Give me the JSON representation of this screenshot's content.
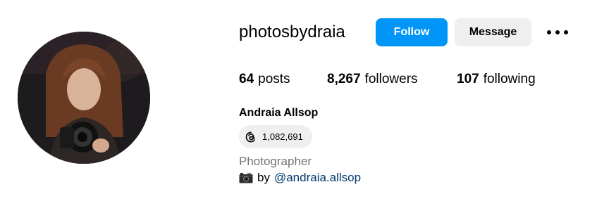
{
  "profile": {
    "username": "photosbydraia",
    "full_name": "Andraia Allsop",
    "category": "Photographer",
    "avatar_icon": "profile-photo-woman-with-camera"
  },
  "actions": {
    "follow_label": "Follow",
    "message_label": "Message",
    "more_icon": "more-options-icon"
  },
  "stats": {
    "posts_count": "64",
    "posts_label": "posts",
    "followers_count": "8,267",
    "followers_label": "followers",
    "following_count": "107",
    "following_label": "following"
  },
  "threads": {
    "icon": "threads-icon",
    "count": "1,082,691"
  },
  "bio": {
    "icon": "camera-emoji",
    "prefix": "by",
    "mention": "@andraia.allsop"
  },
  "colors": {
    "accent": "#0095f6",
    "secondary_button": "#efefef",
    "muted_text": "#737373",
    "link": "#00376b"
  }
}
